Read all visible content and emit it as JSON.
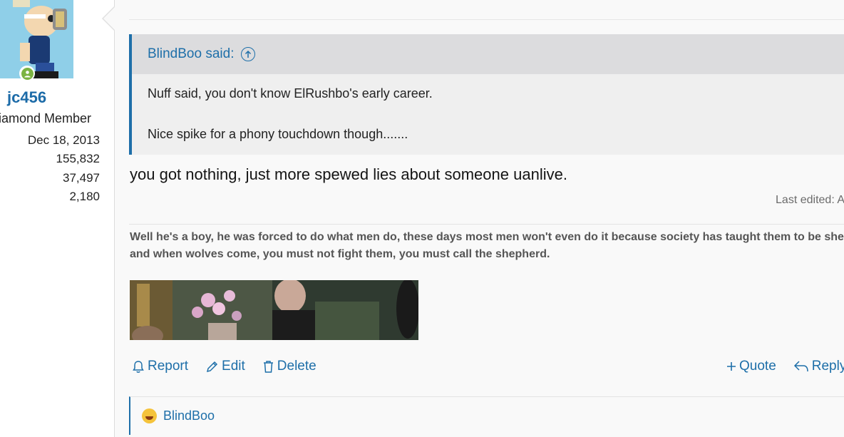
{
  "user": {
    "username": "jc456",
    "title": "Diamond Member",
    "stats": [
      "Dec 18, 2013",
      "155,832",
      "37,497",
      "2,180"
    ]
  },
  "quote": {
    "author_label": "BlindBoo said:",
    "lines": [
      "Nuff said, you don't know ElRushbo's early career.",
      "Nice spike for a phony touchdown though......."
    ]
  },
  "post": {
    "body": "you got nothing, just more spewed lies about someone uanlive.",
    "last_edited": "Last edited: A"
  },
  "signature": {
    "text": "Well he's a boy, he was forced to do what men do, these days most men won't even do it because society has taught them to be sheep and when wolves come, you must not fight them, you must call the shepherd."
  },
  "actions": {
    "report": "Report",
    "edit": "Edit",
    "delete": "Delete",
    "quote": "Quote",
    "reply": "Reply"
  },
  "reactions": {
    "users": "BlindBoo",
    "icon": "laughing-emoji-icon"
  },
  "colors": {
    "link": "#1e6fa9",
    "quote_bar": "#1e6fa9",
    "online": "#7cb342"
  }
}
